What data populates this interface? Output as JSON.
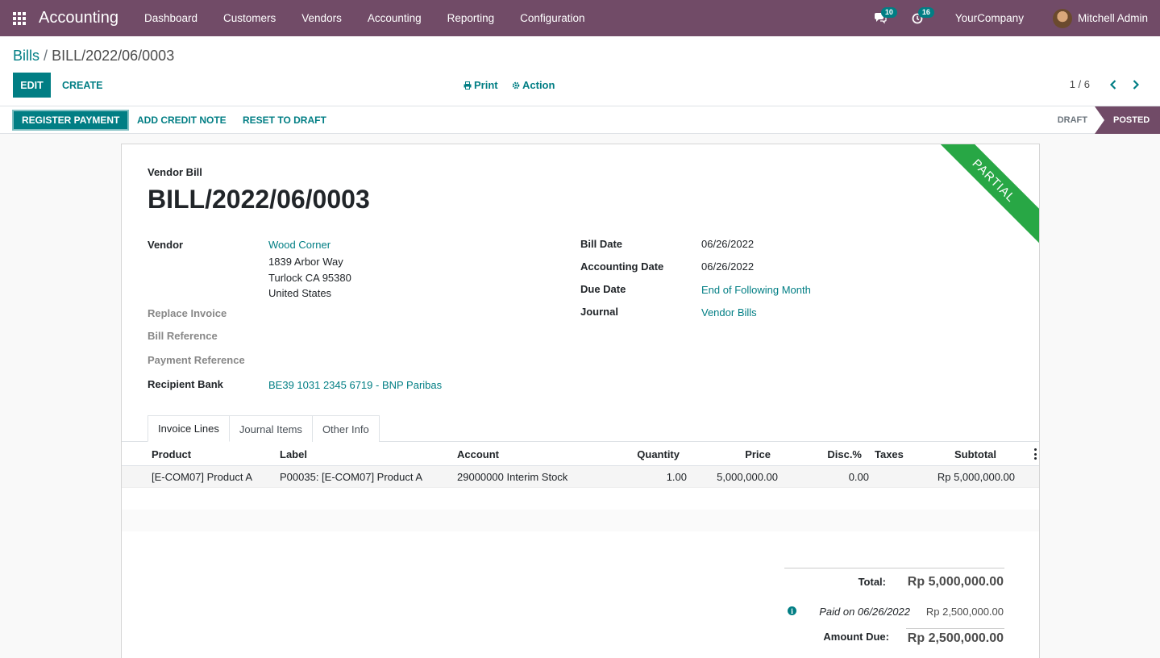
{
  "navbar": {
    "app_name": "Accounting",
    "menu": [
      "Dashboard",
      "Customers",
      "Vendors",
      "Accounting",
      "Reporting",
      "Configuration"
    ],
    "messages_count": "10",
    "activities_count": "16",
    "company": "YourCompany",
    "user": "Mitchell Admin"
  },
  "breadcrumb": {
    "parent": "Bills",
    "separator": "/",
    "current": "BILL/2022/06/0003"
  },
  "control_panel": {
    "edit_label": "EDIT",
    "create_label": "CREATE",
    "print_label": "Print",
    "action_label": "Action",
    "pager": "1 / 6"
  },
  "statusbar": {
    "register_payment": "REGISTER PAYMENT",
    "add_credit_note": "ADD CREDIT NOTE",
    "reset_to_draft": "RESET TO DRAFT",
    "states": [
      "DRAFT",
      "POSTED"
    ]
  },
  "sheet": {
    "ribbon": "PARTIAL",
    "doc_type": "Vendor Bill",
    "doc_name": "BILL/2022/06/0003",
    "left_fields": {
      "vendor_label": "Vendor",
      "vendor_name": "Wood Corner",
      "vendor_address": [
        "1839 Arbor Way",
        "Turlock CA 95380",
        "United States"
      ],
      "replace_invoice_label": "Replace Invoice",
      "bill_reference_label": "Bill Reference",
      "payment_reference_label": "Payment Reference",
      "recipient_bank_label": "Recipient Bank",
      "recipient_bank_value": "BE39 1031 2345 6719 - BNP Paribas"
    },
    "right_fields": {
      "bill_date_label": "Bill Date",
      "bill_date_value": "06/26/2022",
      "accounting_date_label": "Accounting Date",
      "accounting_date_value": "06/26/2022",
      "due_date_label": "Due Date",
      "due_date_value": "End of Following Month",
      "journal_label": "Journal",
      "journal_value": "Vendor Bills"
    },
    "tabs": [
      "Invoice Lines",
      "Journal Items",
      "Other Info"
    ],
    "table": {
      "headers": [
        "Product",
        "Label",
        "Account",
        "Quantity",
        "Price",
        "Disc.%",
        "Taxes",
        "Subtotal"
      ],
      "rows": [
        [
          "[E-COM07] Product A",
          "P00035: [E-COM07] Product A",
          "29000000 Interim Stock",
          "1.00",
          "5,000,000.00",
          "0.00",
          "",
          "Rp 5,000,000.00"
        ]
      ]
    },
    "totals": {
      "total_label": "Total:",
      "total_value": "Rp 5,000,000.00",
      "paid_label": "Paid on 06/26/2022",
      "paid_value": "Rp 2,500,000.00",
      "amount_due_label": "Amount Due:",
      "amount_due_value": "Rp 2,500,000.00"
    }
  },
  "colors": {
    "navbar": "#714b67",
    "primary": "#017e84",
    "ribbon": "#28a745"
  }
}
